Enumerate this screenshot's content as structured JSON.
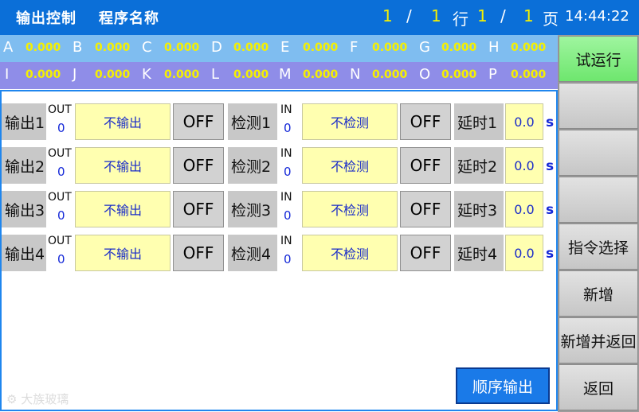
{
  "header": {
    "title": "输出控制",
    "program_name": "程序名称",
    "row_current": "1",
    "row_sep": "/",
    "row_total": "1",
    "row_label": "行",
    "page_current": "1",
    "page_sep": "/",
    "page_total": "1",
    "page_label": "页",
    "time": "14:44:22"
  },
  "axes_row1": [
    {
      "letter": "A",
      "value": "0.000"
    },
    {
      "letter": "B",
      "value": "0.000"
    },
    {
      "letter": "C",
      "value": "0.000"
    },
    {
      "letter": "D",
      "value": "0.000"
    },
    {
      "letter": "E",
      "value": "0.000"
    },
    {
      "letter": "F",
      "value": "0.000"
    },
    {
      "letter": "G",
      "value": "0.000"
    },
    {
      "letter": "H",
      "value": "0.000"
    }
  ],
  "axes_row2": [
    {
      "letter": "I",
      "value": "0.000"
    },
    {
      "letter": "J",
      "value": "0.000"
    },
    {
      "letter": "K",
      "value": "0.000"
    },
    {
      "letter": "L",
      "value": "0.000"
    },
    {
      "letter": "M",
      "value": "0.000"
    },
    {
      "letter": "N",
      "value": "0.000"
    },
    {
      "letter": "O",
      "value": "0.000"
    },
    {
      "letter": "P",
      "value": "0.000"
    }
  ],
  "rows": [
    {
      "out_label": "输出1",
      "out_tag": "OUT",
      "out_num": "0",
      "out_value": "不输出",
      "out_state": "OFF",
      "det_label": "检测1",
      "det_tag": "IN",
      "det_num": "0",
      "det_value": "不检测",
      "det_state": "OFF",
      "delay_label": "延时1",
      "delay_value": "0.0",
      "delay_unit": "s"
    },
    {
      "out_label": "输出2",
      "out_tag": "OUT",
      "out_num": "0",
      "out_value": "不输出",
      "out_state": "OFF",
      "det_label": "检测2",
      "det_tag": "IN",
      "det_num": "0",
      "det_value": "不检测",
      "det_state": "OFF",
      "delay_label": "延时2",
      "delay_value": "0.0",
      "delay_unit": "s"
    },
    {
      "out_label": "输出3",
      "out_tag": "OUT",
      "out_num": "0",
      "out_value": "不输出",
      "out_state": "OFF",
      "det_label": "检测3",
      "det_tag": "IN",
      "det_num": "0",
      "det_value": "不检测",
      "det_state": "OFF",
      "delay_label": "延时3",
      "delay_value": "0.0",
      "delay_unit": "s"
    },
    {
      "out_label": "输出4",
      "out_tag": "OUT",
      "out_num": "0",
      "out_value": "不输出",
      "out_state": "OFF",
      "det_label": "检测4",
      "det_tag": "IN",
      "det_num": "0",
      "det_value": "不检测",
      "det_state": "OFF",
      "delay_label": "延时4",
      "delay_value": "0.0",
      "delay_unit": "s"
    }
  ],
  "sequence_button": "顺序输出",
  "watermark": "大族玻璃",
  "sidebar": {
    "trial_run": "试运行",
    "blank1": "",
    "blank2": "",
    "blank3": "",
    "command_select": "指令选择",
    "add_new": "新增",
    "add_and_return": "新增并返回",
    "back": "返回"
  },
  "colors": {
    "header_bg": "#0b6fd8",
    "axis_row1_bg": "#7fbdf0",
    "axis_row2_bg": "#8f8de8",
    "value_yellow": "#f5f000",
    "field_bg": "#ffffb0",
    "accent_blue": "#1a7ae8",
    "trial_run_green": "#7ee97e"
  }
}
